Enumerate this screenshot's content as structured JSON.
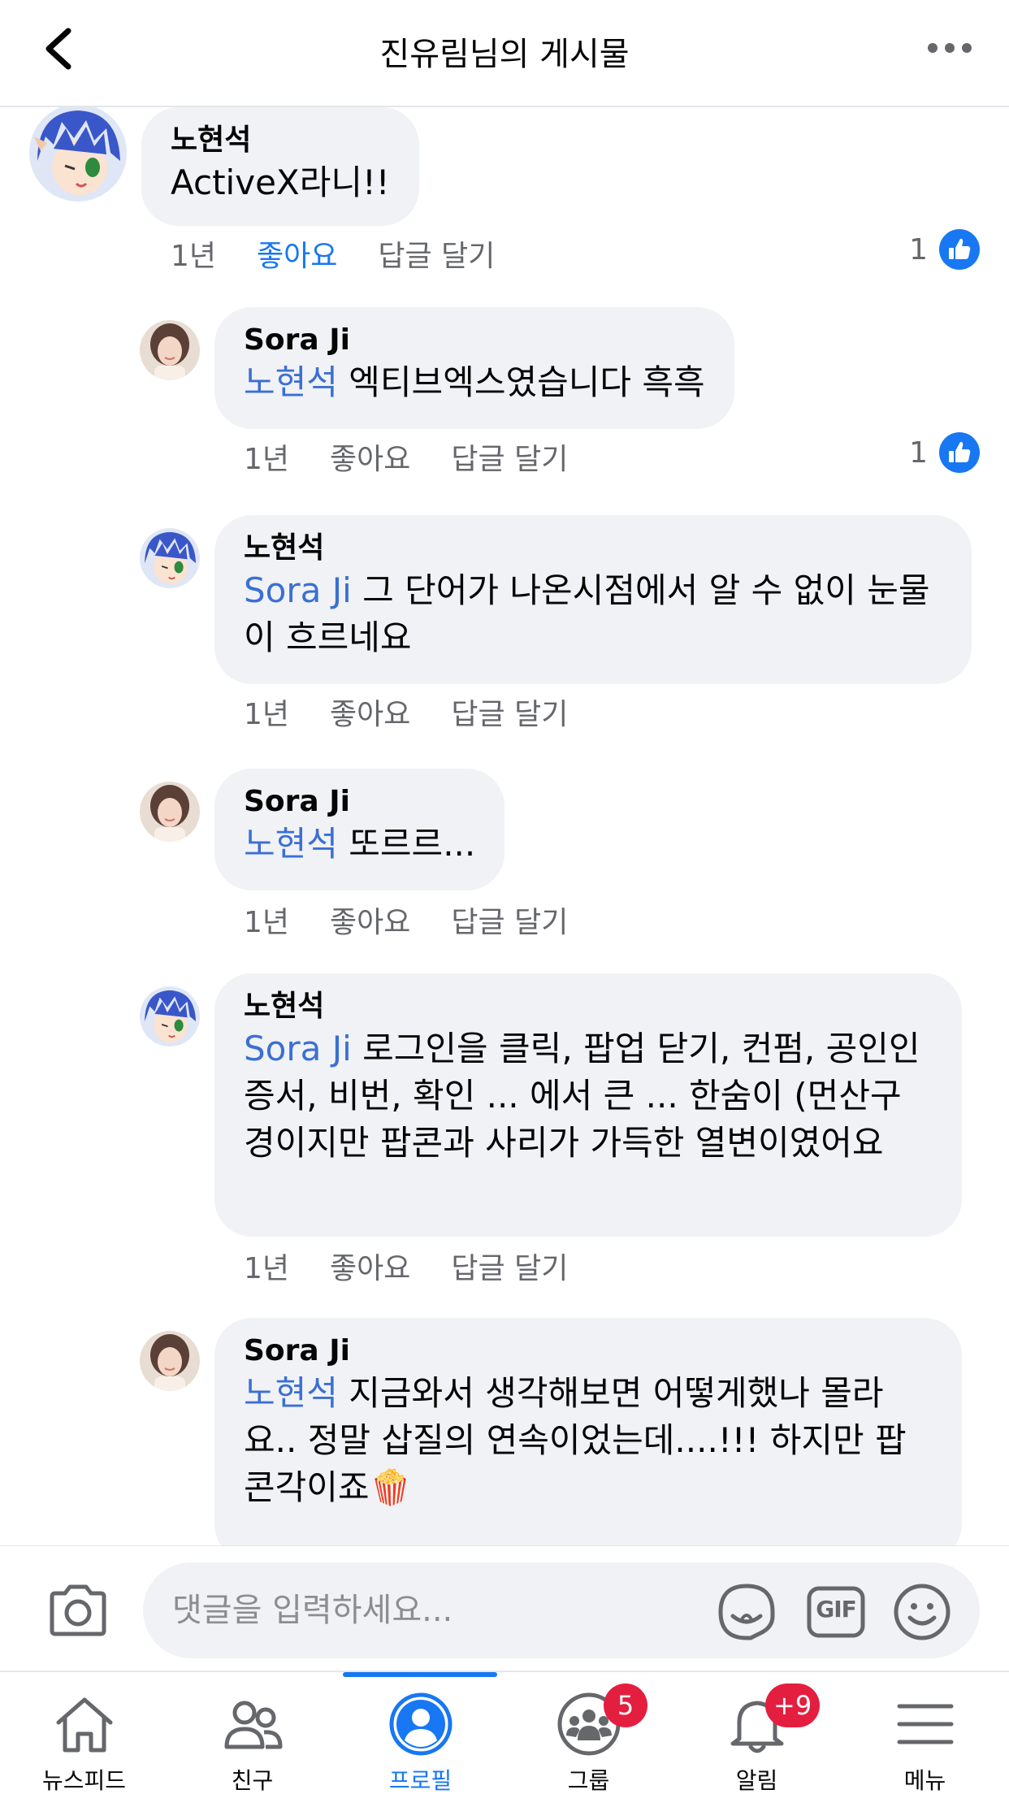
{
  "header": {
    "title": "진유림님의 게시물"
  },
  "comments": [
    {
      "author": "노현석",
      "mention": "",
      "text": "ActiveX라니!!",
      "time": "1년",
      "like": "좋아요",
      "reply": "답글 달기",
      "like_count": "1",
      "liked": true
    },
    {
      "author": "Sora Ji",
      "mention": "노현석",
      "text": " 엑티브엑스였습니다 흑흑",
      "time": "1년",
      "like": "좋아요",
      "reply": "답글 달기",
      "like_count": "1",
      "liked": false
    },
    {
      "author": "노현석",
      "mention": "Sora Ji",
      "text": " 그 단어가 나온시점에서 알 수 없이 눈물이 흐르네요",
      "time": "1년",
      "like": "좋아요",
      "reply": "답글 달기",
      "liked": false
    },
    {
      "author": "Sora Ji",
      "mention": "노현석",
      "text": " 또르르...",
      "time": "1년",
      "like": "좋아요",
      "reply": "답글 달기",
      "liked": false
    },
    {
      "author": "노현석",
      "mention": "Sora Ji",
      "text": " 로그인을 클릭, 팝업 닫기, 컨펌, 공인인증서, 비번, 확인 ... 에서 큰 ... 한숨이 (먼산구경이지만 팝콘과 사리가 가득한 열변이였어요",
      "time": "1년",
      "like": "좋아요",
      "reply": "답글 달기",
      "liked": false
    },
    {
      "author": "Sora Ji",
      "mention": "노현석",
      "text": " 지금와서 생각해보면 어떻게했나 몰라요.. 정말 삽질의 연속이었는데....!!! 하지만 팝콘각이죠🍿",
      "liked": false
    }
  ],
  "composer": {
    "placeholder": "댓글을 입력하세요...",
    "gif_label": "GIF"
  },
  "nav": {
    "items": [
      {
        "label": "뉴스피드",
        "icon": "home-icon"
      },
      {
        "label": "친구",
        "icon": "friends-icon"
      },
      {
        "label": "프로필",
        "icon": "profile-icon"
      },
      {
        "label": "그룹",
        "icon": "groups-icon",
        "badge": "5"
      },
      {
        "label": "알림",
        "icon": "bell-icon",
        "badge": "+9"
      },
      {
        "label": "메뉴",
        "icon": "menu-icon"
      }
    ],
    "active": "프로필"
  },
  "colors": {
    "accent": "#1877f2",
    "mention": "#3b6fd3",
    "bubble": "#f0f2f5",
    "badge": "#e41e3f"
  }
}
